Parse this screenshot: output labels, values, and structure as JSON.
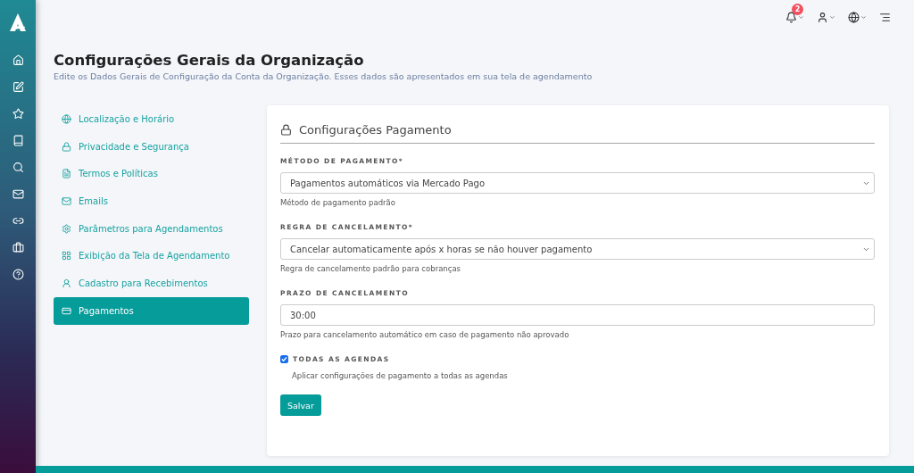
{
  "topbar": {
    "notification_count": "2"
  },
  "page": {
    "title": "Configurações Gerais da Organização",
    "subtitle": "Edite os Dados Gerais de Configuração da Conta da Organização. Esses dados são apresentados em sua tela de agendamento"
  },
  "menu": [
    {
      "label": "Localização e Horário",
      "selected": false
    },
    {
      "label": "Privacidade e Segurança",
      "selected": false
    },
    {
      "label": "Termos e Políticas",
      "selected": false
    },
    {
      "label": "Emails",
      "selected": false
    },
    {
      "label": "Parâmetros para Agendamentos",
      "selected": false
    },
    {
      "label": "Exibição da Tela de Agendamento",
      "selected": false
    },
    {
      "label": "Cadastro para Recebimentos",
      "selected": false
    },
    {
      "label": "Pagamentos",
      "selected": true
    }
  ],
  "card": {
    "title": "Configurações Pagamento",
    "fields": [
      {
        "kind": "select",
        "label": "MÉTODO DE PAGAMENTO*",
        "value": "Pagamentos automáticos via Mercado Pago",
        "help": "Método de pagamento padrão"
      },
      {
        "kind": "select",
        "label": "REGRA DE CANCELAMENTO*",
        "value": "Cancelar automaticamente após x horas se não houver pagamento",
        "help": "Regra de cancelamento padrão para cobranças"
      },
      {
        "kind": "text",
        "label": "PRAZO DE CANCELAMENTO",
        "value": "30:00",
        "help": "Prazo para cancelamento automático em caso de pagamento não aprovado"
      }
    ],
    "checkbox": {
      "label": "TODAS AS AGENDAS",
      "checked": true,
      "help": "Aplicar configurações de pagamento a todas as agendas"
    },
    "button": "Salvar"
  }
}
